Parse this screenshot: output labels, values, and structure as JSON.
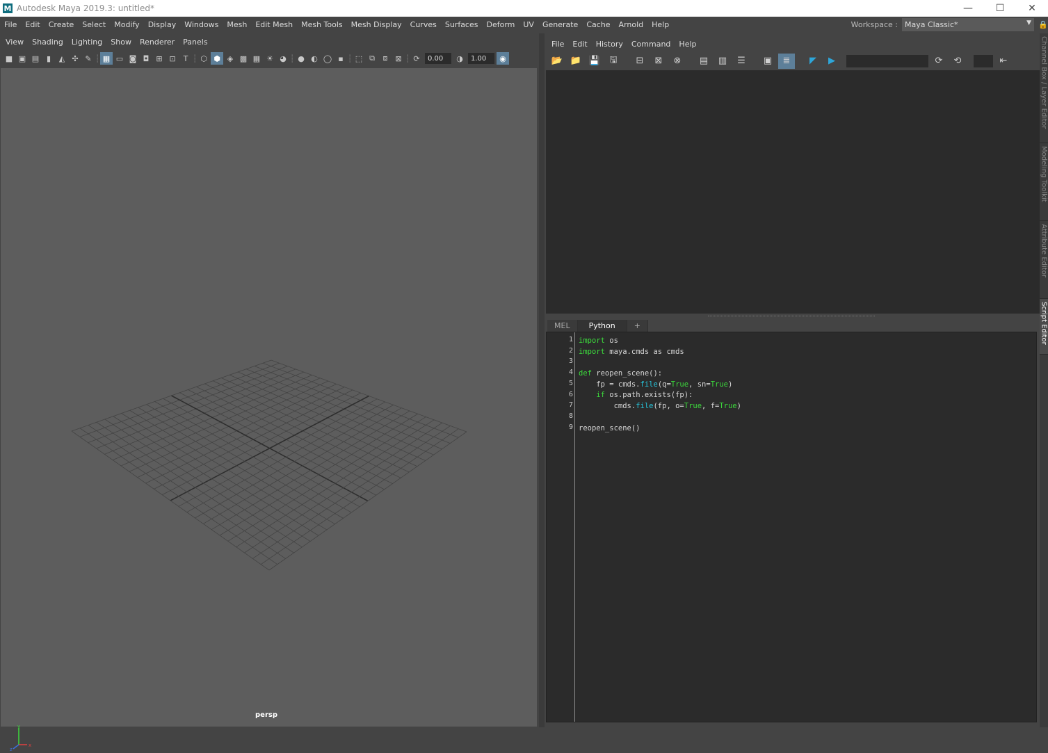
{
  "window": {
    "app_icon": "M",
    "title": "Autodesk Maya 2019.3: untitled*",
    "minimize": "—",
    "maximize": "☐",
    "close": "✕"
  },
  "main_menu": [
    "File",
    "Edit",
    "Create",
    "Select",
    "Modify",
    "Display",
    "Windows",
    "Mesh",
    "Edit Mesh",
    "Mesh Tools",
    "Mesh Display",
    "Curves",
    "Surfaces",
    "Deform",
    "UV",
    "Generate",
    "Cache",
    "Arnold",
    "Help"
  ],
  "workspace": {
    "label": "Workspace :",
    "value": "Maya Classic*"
  },
  "viewport": {
    "menu": [
      "View",
      "Shading",
      "Lighting",
      "Show",
      "Renderer",
      "Panels"
    ],
    "field_exposure": "0.00",
    "field_gamma": "1.00",
    "camera_label": "persp",
    "axis_labels": {
      "y": "y",
      "x": "x",
      "z": "z"
    }
  },
  "script_editor": {
    "menu": [
      "File",
      "Edit",
      "History",
      "Command",
      "Help"
    ],
    "tabs": [
      "MEL",
      "Python",
      "+"
    ],
    "active_tab": "Python",
    "line_numbers": [
      "1",
      "2",
      "3",
      "4",
      "5",
      "6",
      "7",
      "8",
      "9"
    ],
    "code": {
      "l1_kw": "import",
      "l1_rest": " os",
      "l2_kw": "import",
      "l2_rest": " maya.cmds as cmds",
      "l4_kw": "def",
      "l4_rest": " reopen_scene():",
      "l5_a": "    fp = cmds.",
      "l5_fn": "file",
      "l5_b": "(q=",
      "l5_t1": "True",
      "l5_c": ", sn=",
      "l5_t2": "True",
      "l5_d": ")",
      "l6_a": "    ",
      "l6_kw": "if",
      "l6_b": " os.path.exists(fp):",
      "l7_a": "        cmds.",
      "l7_fn": "file",
      "l7_b": "(fp, o=",
      "l7_t1": "True",
      "l7_c": ", f=",
      "l7_t2": "True",
      "l7_d": ")",
      "l9": "reopen_scene()"
    }
  },
  "side_tabs": [
    "Channel Box / Layer Editor",
    "Modeling Toolkit",
    "Attribute Editor",
    "Script Editor"
  ],
  "colors": {
    "accent": "#5d7f99",
    "keyword": "#3cd93c",
    "builtin": "#26c6dd",
    "viewport_bg": "#5d5d5d"
  }
}
